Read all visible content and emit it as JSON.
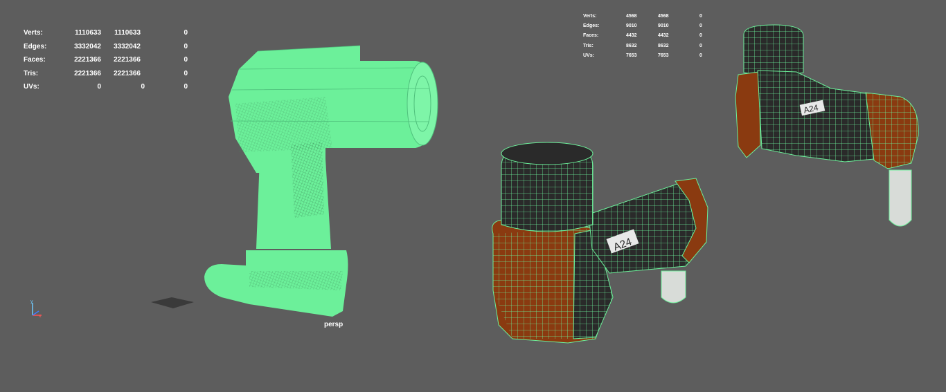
{
  "viewport": {
    "background": "#5d5d5d",
    "camera_label": "persp",
    "wireframe_color": "#6cf09a",
    "diffuse_orange": "#8a3a10",
    "diffuse_dark": "#2a2a2a"
  },
  "hud_left": {
    "rows": [
      {
        "label": "Verts:",
        "v1": "1110633",
        "v2": "1110633",
        "v3": "0"
      },
      {
        "label": "Edges:",
        "v1": "3332042",
        "v2": "3332042",
        "v3": "0"
      },
      {
        "label": "Faces:",
        "v1": "2221366",
        "v2": "2221366",
        "v3": "0"
      },
      {
        "label": "Tris:",
        "v1": "2221366",
        "v2": "2221366",
        "v3": "0"
      },
      {
        "label": "UVs:",
        "v1": "0",
        "v2": "0",
        "v3": "0"
      }
    ]
  },
  "hud_right": {
    "rows": [
      {
        "label": "Verts:",
        "v1": "4568",
        "v2": "4568",
        "v3": "0"
      },
      {
        "label": "Edges:",
        "v1": "9010",
        "v2": "9010",
        "v3": "0"
      },
      {
        "label": "Faces:",
        "v1": "4432",
        "v2": "4432",
        "v3": "0"
      },
      {
        "label": "Tris:",
        "v1": "8632",
        "v2": "8632",
        "v3": "0"
      },
      {
        "label": "UVs:",
        "v1": "7653",
        "v2": "7653",
        "v3": "0"
      }
    ]
  },
  "model_label": "A24",
  "axis_icon": "xyz-axis-gizmo-icon"
}
